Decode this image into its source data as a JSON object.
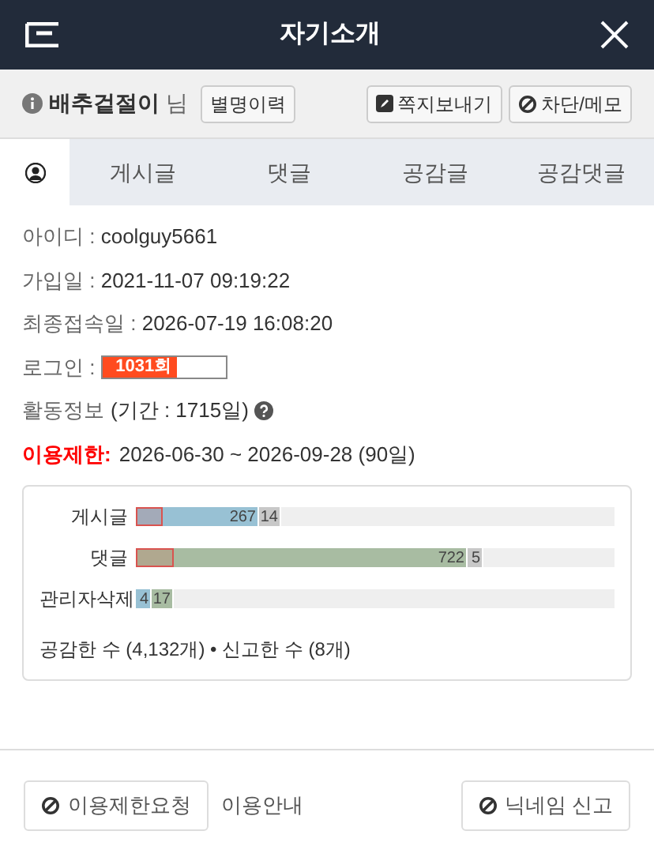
{
  "header": {
    "title": "자기소개"
  },
  "user": {
    "nickname": "배추겉절이",
    "suffix": "님",
    "history_button": "별명이력",
    "actions": [
      "쪽지보내기",
      "차단/메모"
    ]
  },
  "tabs": [
    {
      "kind": "profile",
      "selected": true
    },
    {
      "label": "게시글",
      "selected": false
    },
    {
      "label": "댓글",
      "selected": false
    },
    {
      "label": "공감글",
      "selected": false
    },
    {
      "label": "공감댓글",
      "selected": false
    }
  ],
  "info": [
    {
      "label": "아이디 : ",
      "value": "coolguy5661"
    },
    {
      "label": "가입일 : ",
      "value": "2021-11-07 09:19:22"
    },
    {
      "label": "최종접속일 : ",
      "value": "2026-07-19 16:08:20"
    }
  ],
  "login": {
    "label": "로그인 : ",
    "value": "1031회",
    "level": 0.6
  },
  "activity": {
    "label": "활동정보",
    "period": "(기간 : 1715일)"
  },
  "restriction": {
    "label": "이용제한:",
    "value": "2026-06-30 ~ 2026-09-28 (90일)"
  },
  "stats": {
    "rows": [
      {
        "label": "게시글",
        "segments": [
          {
            "kind": "flagged",
            "color": "#a3aab8"
          },
          {
            "kind": "count",
            "color": "#98c1d4",
            "label": "267"
          },
          {
            "kind": "count",
            "color": "#c8c8c8",
            "label": "14"
          }
        ]
      },
      {
        "label": "댓글",
        "segments": [
          {
            "kind": "flagged",
            "color": "#b0a88f"
          },
          {
            "kind": "count",
            "color": "#a8bca2",
            "label": "722"
          },
          {
            "kind": "count",
            "color": "#c8c8c8",
            "label": "5"
          }
        ]
      },
      {
        "label": "관리자삭제",
        "segments": [
          {
            "kind": "count",
            "color": "#98c1d4",
            "label": "4"
          },
          {
            "kind": "count",
            "color": "#a8bca2",
            "label": "17"
          }
        ]
      }
    ],
    "summary": "공감한 수 (4,132개) • 신고한 수 (8개)"
  },
  "footer": {
    "request_button": "이용제한요청",
    "guide_link": "이용안내",
    "report_button": "닉네임 신고"
  }
}
